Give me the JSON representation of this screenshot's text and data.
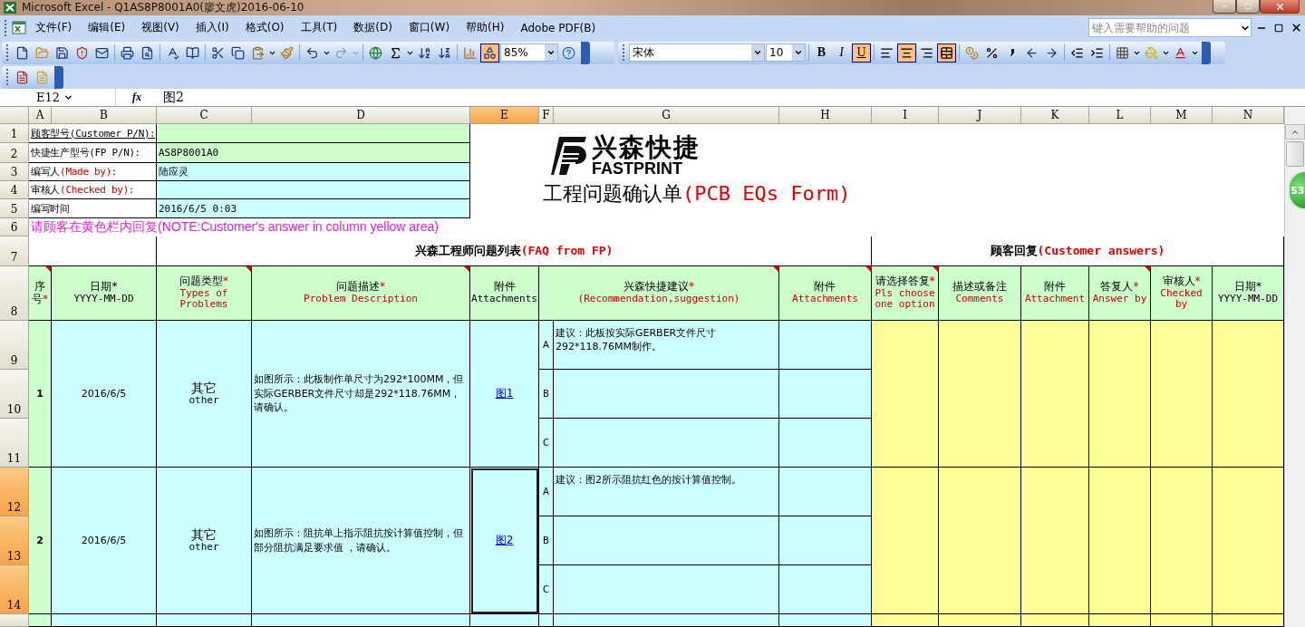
{
  "window": {
    "title": "Microsoft Excel - Q1AS8P8001A0(廖文虎)2016-06-10"
  },
  "menu": {
    "items": [
      "文件(F)",
      "编辑(E)",
      "视图(V)",
      "插入(I)",
      "格式(O)",
      "工具(T)",
      "数据(D)",
      "窗口(W)",
      "帮助(H)",
      "Adobe PDF(B)"
    ],
    "help_placeholder": "键入需要帮助的问题"
  },
  "standard_toolbar": {
    "zoom": "85%",
    "drawing_on": true
  },
  "format_toolbar": {
    "font": "宋体",
    "size": "10",
    "styles": [
      {
        "label": "B",
        "on": false
      },
      {
        "label": "I",
        "on": false
      },
      {
        "label": "U",
        "on": true
      }
    ],
    "align": [
      {
        "kind": "left",
        "selected": false
      },
      {
        "kind": "center",
        "selected": true
      },
      {
        "kind": "right",
        "selected": false
      }
    ],
    "merge_on": true
  },
  "formula_bar": {
    "name_box": "E12",
    "fx": "fx",
    "value": "图2"
  },
  "sheet": {
    "columns": [
      {
        "label": "A",
        "selected": false
      },
      {
        "label": "B",
        "selected": false
      },
      {
        "label": "C",
        "selected": false
      },
      {
        "label": "D",
        "selected": false
      },
      {
        "label": "E",
        "selected": true
      },
      {
        "label": "F",
        "selected": false
      },
      {
        "label": "G",
        "selected": false
      },
      {
        "label": "H",
        "selected": false
      },
      {
        "label": "I",
        "selected": false
      },
      {
        "label": "J",
        "selected": false
      },
      {
        "label": "K",
        "selected": false
      },
      {
        "label": "L",
        "selected": false
      },
      {
        "label": "M",
        "selected": false
      },
      {
        "label": "N",
        "selected": false
      }
    ],
    "rows": [
      {
        "label": "1",
        "selected": false
      },
      {
        "label": "2",
        "selected": false
      },
      {
        "label": "3",
        "selected": false
      },
      {
        "label": "4",
        "selected": false
      },
      {
        "label": "5",
        "selected": false
      },
      {
        "label": "6",
        "selected": false
      },
      {
        "label": "7",
        "selected": false
      },
      {
        "label": "8",
        "selected": false
      },
      {
        "label": "9",
        "selected": false
      },
      {
        "label": "10",
        "selected": false
      },
      {
        "label": "11",
        "selected": false
      },
      {
        "label": "12",
        "selected": true
      },
      {
        "label": "13",
        "selected": true
      },
      {
        "label": "14",
        "selected": true
      }
    ],
    "info": [
      {
        "zh": "顾客型号",
        "en": {
          "text": "(Customer P/N)",
          "color": "#000000"
        },
        "suffix": ":",
        "underline": true,
        "color": "#ccffcc"
      },
      {
        "zh": "快捷生产型号",
        "en": {
          "text": "(FP P/N)",
          "color": "#000000"
        },
        "suffix": ":",
        "underline": false,
        "value": "AS8P8001A0",
        "color": "#ccffcc"
      },
      {
        "zh": "编写人",
        "en": {
          "text": "(Made by)",
          "color": "#cc0000"
        },
        "suffix": ":",
        "underline": false,
        "value": "陆应灵",
        "color": "#ccffff"
      },
      {
        "zh": "审核人",
        "en": {
          "text": "(Checked by)",
          "color": "#cc0000"
        },
        "suffix": ":",
        "underline": false,
        "color": "#ccffff"
      },
      {
        "zh": "编写时间",
        "underline": false,
        "value": "2016/6/5 0:03",
        "color": "#ccffff"
      }
    ],
    "note": "请顾客在黄色栏内回复(NOTE:Customer's answer in column yellow area)",
    "logo": {
      "name": "兴森快捷",
      "latin": "FASTPRINT"
    },
    "form_title": {
      "zh": "工程问题确认单",
      "en": "(PCB EQs Form)"
    },
    "sections": [
      {
        "zh": "兴森工程师问题列表",
        "en": "(FAQ from FP)"
      },
      {
        "zh": "顾客回复",
        "en": "(Customer answers)"
      }
    ],
    "headers": [
      {
        "zh": "序号",
        "mark": "*",
        "comment": true
      },
      {
        "zh": "日期*",
        "en": "YYYY-MM-DD",
        "comment": false,
        "color": "#000000"
      },
      {
        "zh": "问题类型",
        "mark": "*",
        "en": "Types of Problems",
        "comment": true,
        "color": "#cc0000"
      },
      {
        "zh": "问题描述",
        "mark": "*",
        "en": "Problem Description",
        "comment": true,
        "color": "#cc0000"
      },
      {
        "zh": "附件",
        "en": "Attachments",
        "comment": false,
        "color": "#000000"
      },
      {
        "zh": "兴森快捷建议",
        "mark": "*",
        "en": "(Recommendation,suggestion)",
        "comment": true,
        "color": "#cc0000"
      },
      {
        "zh": "附件",
        "en": "Attachments",
        "comment": true,
        "color": "#cc0000"
      },
      {
        "zh": "请选择答复",
        "mark": "*",
        "en": "Pls choose one option",
        "comment": true,
        "color": "#cc0000"
      },
      {
        "zh": "描述或备注",
        "en": "Comments",
        "comment": false,
        "color": "#cc0000"
      },
      {
        "zh": "附件",
        "en": "Attachment",
        "comment": false,
        "color": "#cc0000"
      },
      {
        "zh": "答复人",
        "mark": "*",
        "en": "Answer by",
        "comment": true,
        "color": "#cc0000"
      },
      {
        "zh": "审核人",
        "mark": "*",
        "en": "Checked by",
        "comment": false,
        "color": "#cc0000"
      },
      {
        "zh": "日期*",
        "en": "YYYY-MM-DD",
        "comment": false,
        "color": "#000000"
      }
    ],
    "problems": [
      {
        "no": "1",
        "date": "2016/6/5",
        "type_zh": "其它",
        "type_en": "other",
        "description": "如图所示：此板制作单尺寸为292*100MM，但实际GERBER文件尺寸却是292*118.76MM，请确认。",
        "attachment": {
          "label": "图1",
          "selected": false
        },
        "options": [
          {
            "letter": "A",
            "text": "建议：此板按实际GERBER文件尺寸292*118.76MM制作。"
          },
          {
            "letter": "B"
          },
          {
            "letter": "C"
          }
        ]
      },
      {
        "no": "2",
        "date": "2016/6/5",
        "type_zh": "其它",
        "type_en": "other",
        "description": "如图所示：阻抗单上指示阻抗按计算值控制，但部分阻抗满足要求值 ，请确认。",
        "attachment": {
          "label": "图2",
          "selected": true
        },
        "options": [
          {
            "letter": "A",
            "text": "建议：图2所示阻抗红色的按计算值控制。"
          },
          {
            "letter": "B"
          },
          {
            "letter": "C"
          }
        ]
      }
    ],
    "badge": "53"
  }
}
